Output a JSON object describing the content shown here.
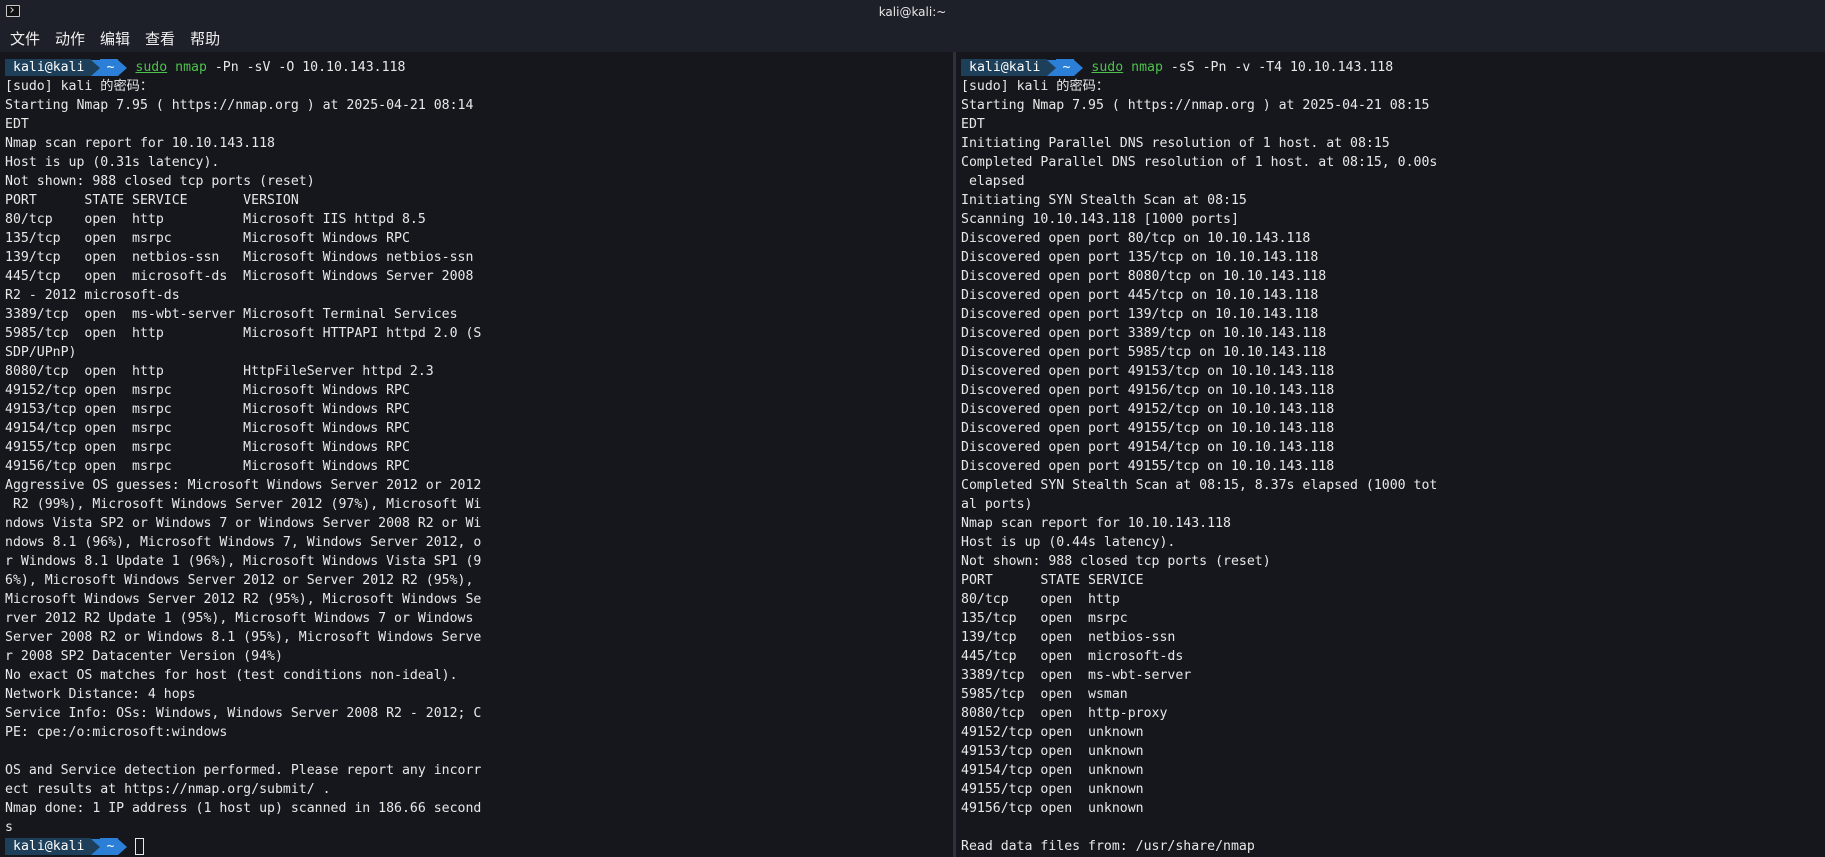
{
  "window": {
    "title": "kali@kali:~"
  },
  "menu": [
    "文件",
    "动作",
    "编辑",
    "查看",
    "帮助"
  ],
  "prompt": {
    "user": "kali@kali",
    "dir": "~"
  },
  "left": {
    "command": {
      "sudo": "sudo",
      "bin": "nmap",
      "args": "-Pn -sV -O 10.10.143.118"
    },
    "output": [
      "[sudo] kali 的密码：",
      "Starting Nmap 7.95 ( https://nmap.org ) at 2025-04-21 08:14",
      "EDT",
      "Nmap scan report for 10.10.143.118",
      "Host is up (0.31s latency).",
      "Not shown: 988 closed tcp ports (reset)",
      "PORT      STATE SERVICE       VERSION",
      "80/tcp    open  http          Microsoft IIS httpd 8.5",
      "135/tcp   open  msrpc         Microsoft Windows RPC",
      "139/tcp   open  netbios-ssn   Microsoft Windows netbios-ssn",
      "445/tcp   open  microsoft-ds  Microsoft Windows Server 2008",
      "R2 - 2012 microsoft-ds",
      "3389/tcp  open  ms-wbt-server Microsoft Terminal Services",
      "5985/tcp  open  http          Microsoft HTTPAPI httpd 2.0 (S",
      "SDP/UPnP)",
      "8080/tcp  open  http          HttpFileServer httpd 2.3",
      "49152/tcp open  msrpc         Microsoft Windows RPC",
      "49153/tcp open  msrpc         Microsoft Windows RPC",
      "49154/tcp open  msrpc         Microsoft Windows RPC",
      "49155/tcp open  msrpc         Microsoft Windows RPC",
      "49156/tcp open  msrpc         Microsoft Windows RPC",
      "Aggressive OS guesses: Microsoft Windows Server 2012 or 2012",
      " R2 (99%), Microsoft Windows Server 2012 (97%), Microsoft Wi",
      "ndows Vista SP2 or Windows 7 or Windows Server 2008 R2 or Wi",
      "ndows 8.1 (96%), Microsoft Windows 7, Windows Server 2012, o",
      "r Windows 8.1 Update 1 (96%), Microsoft Windows Vista SP1 (9",
      "6%), Microsoft Windows Server 2012 or Server 2012 R2 (95%),",
      "Microsoft Windows Server 2012 R2 (95%), Microsoft Windows Se",
      "rver 2012 R2 Update 1 (95%), Microsoft Windows 7 or Windows",
      "Server 2008 R2 or Windows 8.1 (95%), Microsoft Windows Serve",
      "r 2008 SP2 Datacenter Version (94%)",
      "No exact OS matches for host (test conditions non-ideal).",
      "Network Distance: 4 hops",
      "Service Info: OSs: Windows, Windows Server 2008 R2 - 2012; C",
      "PE: cpe:/o:microsoft:windows",
      "",
      "OS and Service detection performed. Please report any incorr",
      "ect results at https://nmap.org/submit/ .",
      "Nmap done: 1 IP address (1 host up) scanned in 186.66 second",
      "s"
    ]
  },
  "right": {
    "command": {
      "sudo": "sudo",
      "bin": "nmap",
      "args": "-sS -Pn -v -T4 10.10.143.118"
    },
    "output": [
      "[sudo] kali 的密码：",
      "Starting Nmap 7.95 ( https://nmap.org ) at 2025-04-21 08:15",
      "EDT",
      "Initiating Parallel DNS resolution of 1 host. at 08:15",
      "Completed Parallel DNS resolution of 1 host. at 08:15, 0.00s",
      " elapsed",
      "Initiating SYN Stealth Scan at 08:15",
      "Scanning 10.10.143.118 [1000 ports]",
      "Discovered open port 80/tcp on 10.10.143.118",
      "Discovered open port 135/tcp on 10.10.143.118",
      "Discovered open port 8080/tcp on 10.10.143.118",
      "Discovered open port 445/tcp on 10.10.143.118",
      "Discovered open port 139/tcp on 10.10.143.118",
      "Discovered open port 3389/tcp on 10.10.143.118",
      "Discovered open port 5985/tcp on 10.10.143.118",
      "Discovered open port 49153/tcp on 10.10.143.118",
      "Discovered open port 49156/tcp on 10.10.143.118",
      "Discovered open port 49152/tcp on 10.10.143.118",
      "Discovered open port 49155/tcp on 10.10.143.118",
      "Discovered open port 49154/tcp on 10.10.143.118",
      "Discovered open port 49155/tcp on 10.10.143.118",
      "Completed SYN Stealth Scan at 08:15, 8.37s elapsed (1000 tot",
      "al ports)",
      "Nmap scan report for 10.10.143.118",
      "Host is up (0.44s latency).",
      "Not shown: 988 closed tcp ports (reset)",
      "PORT      STATE SERVICE",
      "80/tcp    open  http",
      "135/tcp   open  msrpc",
      "139/tcp   open  netbios-ssn",
      "445/tcp   open  microsoft-ds",
      "3389/tcp  open  ms-wbt-server",
      "5985/tcp  open  wsman",
      "8080/tcp  open  http-proxy",
      "49152/tcp open  unknown",
      "49153/tcp open  unknown",
      "49154/tcp open  unknown",
      "49155/tcp open  unknown",
      "49156/tcp open  unknown",
      "",
      "Read data files from: /usr/share/nmap"
    ]
  }
}
